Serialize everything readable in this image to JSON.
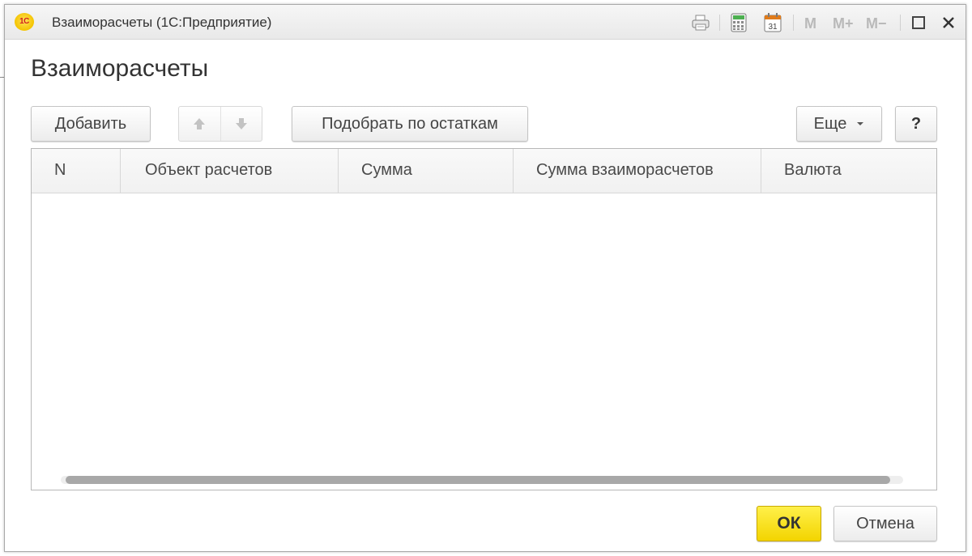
{
  "window": {
    "app_logo_text": "1С",
    "title": "Взаиморасчеты  (1С:Предприятие)",
    "memory_buttons": [
      "M",
      "M+",
      "M−"
    ],
    "calendar_day": "31"
  },
  "form": {
    "title": "Взаиморасчеты"
  },
  "toolbar": {
    "add_label": "Добавить",
    "pick_label": "Подобрать по остаткам",
    "more_label": "Еще",
    "help_label": "?"
  },
  "table": {
    "columns": [
      "N",
      "Объект расчетов",
      "Сумма",
      "Сумма взаиморасчетов",
      "Валюта"
    ],
    "rows": []
  },
  "footer": {
    "ok_label": "ОК",
    "cancel_label": "Отмена"
  },
  "colors": {
    "ok_button": "#f3d400",
    "accent_green": "#4caf50",
    "accent_orange": "#e07b1a"
  }
}
